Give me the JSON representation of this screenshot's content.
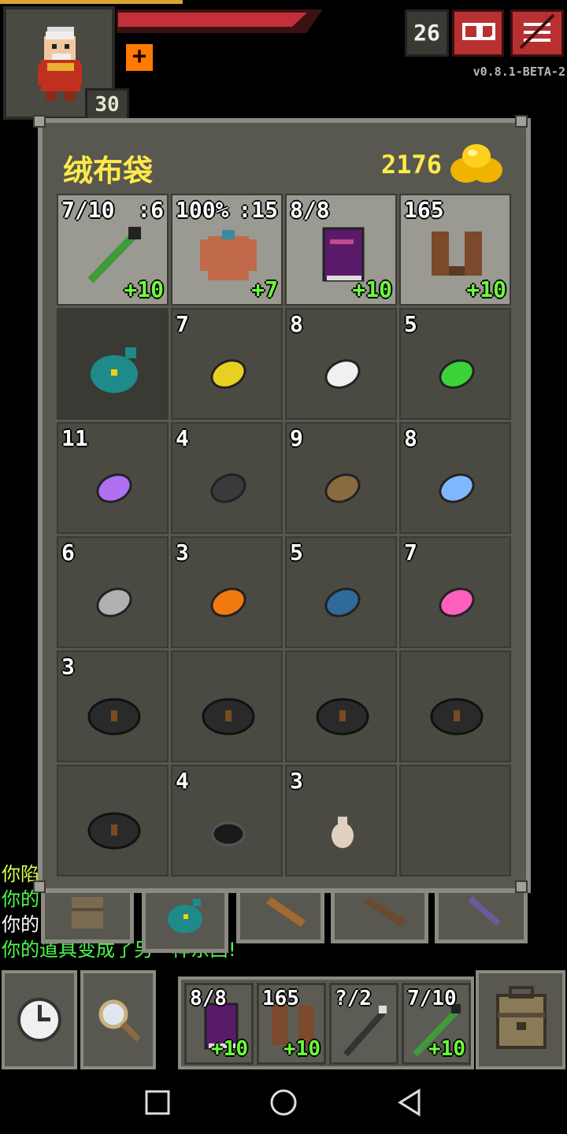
{
  "status": {
    "depth": "26",
    "hero_level": "30",
    "version": "v0.8.1-BETA-2",
    "buff_symbol": "+",
    "journal_icon": "journal-icon",
    "menu_icon": "menu-icon"
  },
  "bag": {
    "title": "绒布袋",
    "gold": "2176",
    "equipped": [
      {
        "name": "weapon",
        "top_left": "7/10",
        "top_right": ":6",
        "level": "+10"
      },
      {
        "name": "armor",
        "top_left": "100%",
        "top_right": ":15",
        "level": "+7"
      },
      {
        "name": "artifact-book",
        "top_left": "8/8",
        "top_right": "",
        "level": "+10"
      },
      {
        "name": "boots",
        "top_left": "165",
        "top_right": "",
        "level": "+10"
      }
    ],
    "items": [
      {
        "name": "velvet-pouch",
        "qty": "",
        "color": "#1f8a8a"
      },
      {
        "name": "yellow-seed",
        "qty": "7",
        "color": "#e8d020"
      },
      {
        "name": "white-seed",
        "qty": "8",
        "color": "#f0f0f0"
      },
      {
        "name": "green-seed",
        "qty": "5",
        "color": "#3ed23a"
      },
      {
        "name": "purple-seed",
        "qty": "11",
        "color": "#b070f0"
      },
      {
        "name": "dark-seed",
        "qty": "4",
        "color": "#3a3a3a"
      },
      {
        "name": "brown-seed",
        "qty": "9",
        "color": "#8a6a40"
      },
      {
        "name": "blue-seed",
        "qty": "8",
        "color": "#80b8ff"
      },
      {
        "name": "grey-seed",
        "qty": "6",
        "color": "#b0b0b0"
      },
      {
        "name": "orange-seed",
        "qty": "3",
        "color": "#f07a10"
      },
      {
        "name": "navy-seed",
        "qty": "5",
        "color": "#2f6a9a"
      },
      {
        "name": "pink-seed",
        "qty": "7",
        "color": "#ff60c0"
      },
      {
        "name": "runestone-1",
        "qty": "3",
        "color": "#2a2a2a"
      },
      {
        "name": "runestone-2",
        "qty": "",
        "color": "#2a2a2a"
      },
      {
        "name": "runestone-3",
        "qty": "",
        "color": "#2a2a2a"
      },
      {
        "name": "runestone-4",
        "qty": "",
        "color": "#2a2a2a"
      },
      {
        "name": "runestone-5",
        "qty": "",
        "color": "#2a2a2a"
      },
      {
        "name": "black-stone",
        "qty": "4",
        "color": "#1a1a1a"
      },
      {
        "name": "small-potion",
        "qty": "3",
        "color": "#e0d0c0"
      },
      {
        "name": "empty",
        "qty": "",
        "color": ""
      }
    ]
  },
  "log": [
    {
      "text": "你陷",
      "color": "#d8ff4a"
    },
    {
      "text": "你的",
      "color": "#4aff4a"
    },
    {
      "text": "你的",
      "color": "#ffffff"
    },
    {
      "text": "你的道具变成了另一样东西!",
      "color": "#4aff4a"
    }
  ],
  "quickslots": [
    {
      "name": "quickslot-book",
      "top_left": "8/8",
      "level": "+10"
    },
    {
      "name": "quickslot-boots",
      "top_left": "165",
      "level": "+10"
    },
    {
      "name": "quickslot-wand",
      "top_left": "?/2",
      "level": ""
    },
    {
      "name": "quickslot-weapon",
      "top_left": "7/10",
      "level": "+10"
    }
  ],
  "colors": {
    "panel": "#585850",
    "panel_border": "#8a8a80",
    "gold_text": "#ffea4a",
    "upgrade_text": "#6cff3a",
    "hp": "#c4303a"
  }
}
